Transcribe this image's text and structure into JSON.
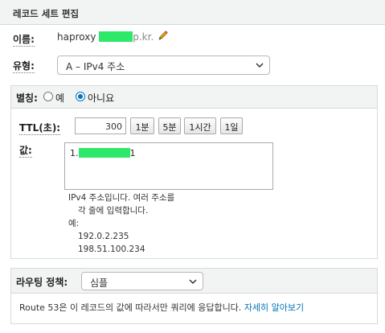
{
  "header": {
    "title": "레코드 세트 편집"
  },
  "name": {
    "label": "이름:",
    "prefix": "haproxy",
    "suffix": "p.kr."
  },
  "type": {
    "label": "유형:",
    "selected": "A – IPv4 주소"
  },
  "alias": {
    "label": "별칭:",
    "option_yes": "예",
    "option_no": "아니요",
    "selected": "아니요"
  },
  "ttl": {
    "label": "TTL(초):",
    "value": "300",
    "buttons": [
      "1분",
      "5분",
      "1시간",
      "1일"
    ]
  },
  "value": {
    "label": "값:",
    "prefix": "1.",
    "suffix": "1",
    "hint_line1": "IPv4 주소입니다. 여러 주소를",
    "hint_line2": "각 줄에 입력합니다.",
    "example_label": "예:",
    "example1": "192.0.2.235",
    "example2": "198.51.100.234"
  },
  "routing": {
    "label": "라우팅 정책:",
    "selected": "심플",
    "description": "Route 53은 이 레코드의 값에 따라서만 쿼리에 응답합니다.",
    "learn_more": "자세히 알아보기"
  },
  "colors": {
    "accent": "#0073bb",
    "mask": "#2ee86a",
    "panel": "#f2f3f3"
  }
}
